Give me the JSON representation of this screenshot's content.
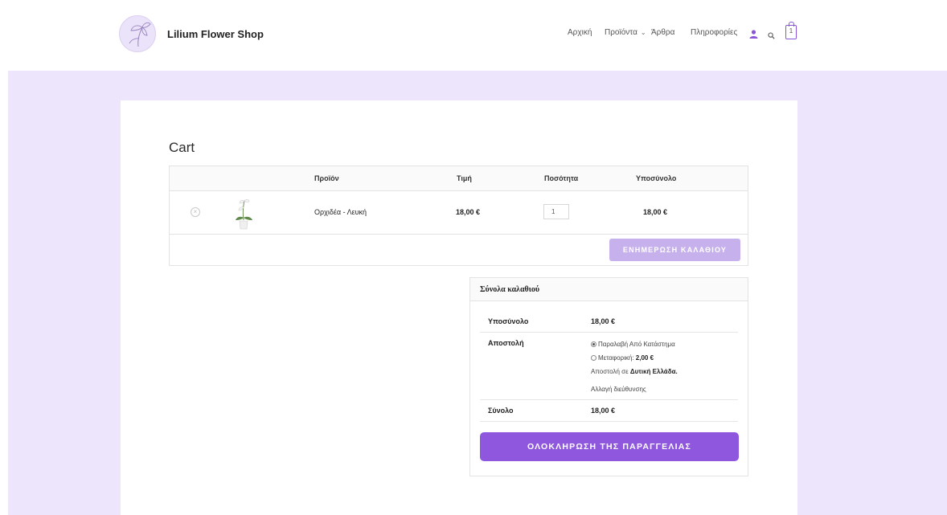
{
  "header": {
    "brand": "Lilium Flower Shop",
    "nav": [
      {
        "label": "Αρχική"
      },
      {
        "label": "Προϊόντα"
      },
      {
        "label": "Άρθρα"
      },
      {
        "label": "Πληροφορίες"
      }
    ],
    "cart_count": "1",
    "accent_color": "#8a55d6"
  },
  "page": {
    "title": "Cart"
  },
  "cart_table": {
    "columns": [
      "Προϊόν",
      "Τιμή",
      "Ποσότητα",
      "Υποσύνολο"
    ],
    "rows": [
      {
        "product": "Ορχιδέα - Λευκή",
        "price": "18,00 €",
        "quantity": "1",
        "subtotal": "18,00 €"
      }
    ],
    "update_button": "ΕΝΗΜΕΡΩΣΗ ΚΑΛΑΘΙΟΥ"
  },
  "totals": {
    "title": "Σύνολα καλαθιού",
    "subtotal_label": "Υποσύνολο",
    "subtotal_value": "18,00 €",
    "shipping_label": "Αποστολή",
    "shipping_option_pickup": "Παραλαβή Από Κατάστημα",
    "shipping_option_courier": "Μεταφορική:",
    "shipping_option_courier_price": "2,00 €",
    "shipping_note_prefix": "Αποστολή σε",
    "shipping_note_region": "Δυτική Ελλάδα.",
    "change_address": "Αλλαγή διεύθυνσης",
    "total_label": "Σύνολο",
    "total_value": "18,00 €",
    "checkout_button": "ΟΛΟΚΛΗΡΩΣΗ ΤΗΣ ΠΑΡΑΓΓΕΛΙΑΣ"
  }
}
